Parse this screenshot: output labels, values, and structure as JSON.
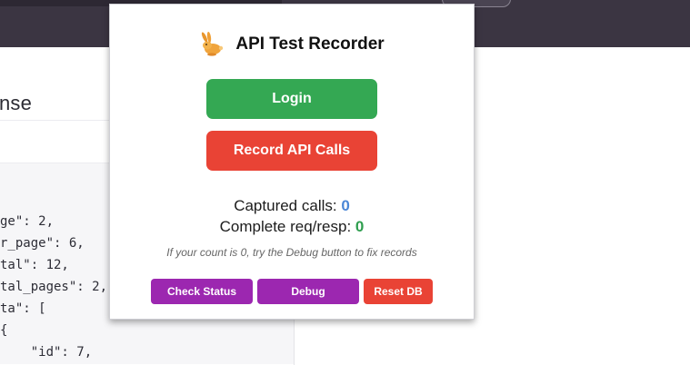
{
  "background_page": {
    "heading_fragment": "nse",
    "code_lines": [
      "ge\": 2,",
      "r_page\": 6,",
      "tal\": 12,",
      "tal_pages\": 2,",
      "ta\": [",
      "{",
      "    \"id\": 7,"
    ]
  },
  "popup": {
    "title": "API Test Recorder",
    "logo_icon": "rabbit-icon",
    "login_label": "Login",
    "record_label": "Record API Calls",
    "captured_label": "Captured calls: ",
    "captured_count": "0",
    "complete_label": "Complete req/resp: ",
    "complete_count": "0",
    "hint": "If your count is 0, try the Debug button to fix records",
    "check_status_label": "Check Status",
    "debug_label": "Debug",
    "reset_db_label": "Reset DB"
  },
  "colors": {
    "login_green": "#34a853",
    "record_red": "#e94335",
    "purple": "#9c27b0",
    "count_blue": "#4a86d6",
    "count_green": "#2f9e4f"
  }
}
